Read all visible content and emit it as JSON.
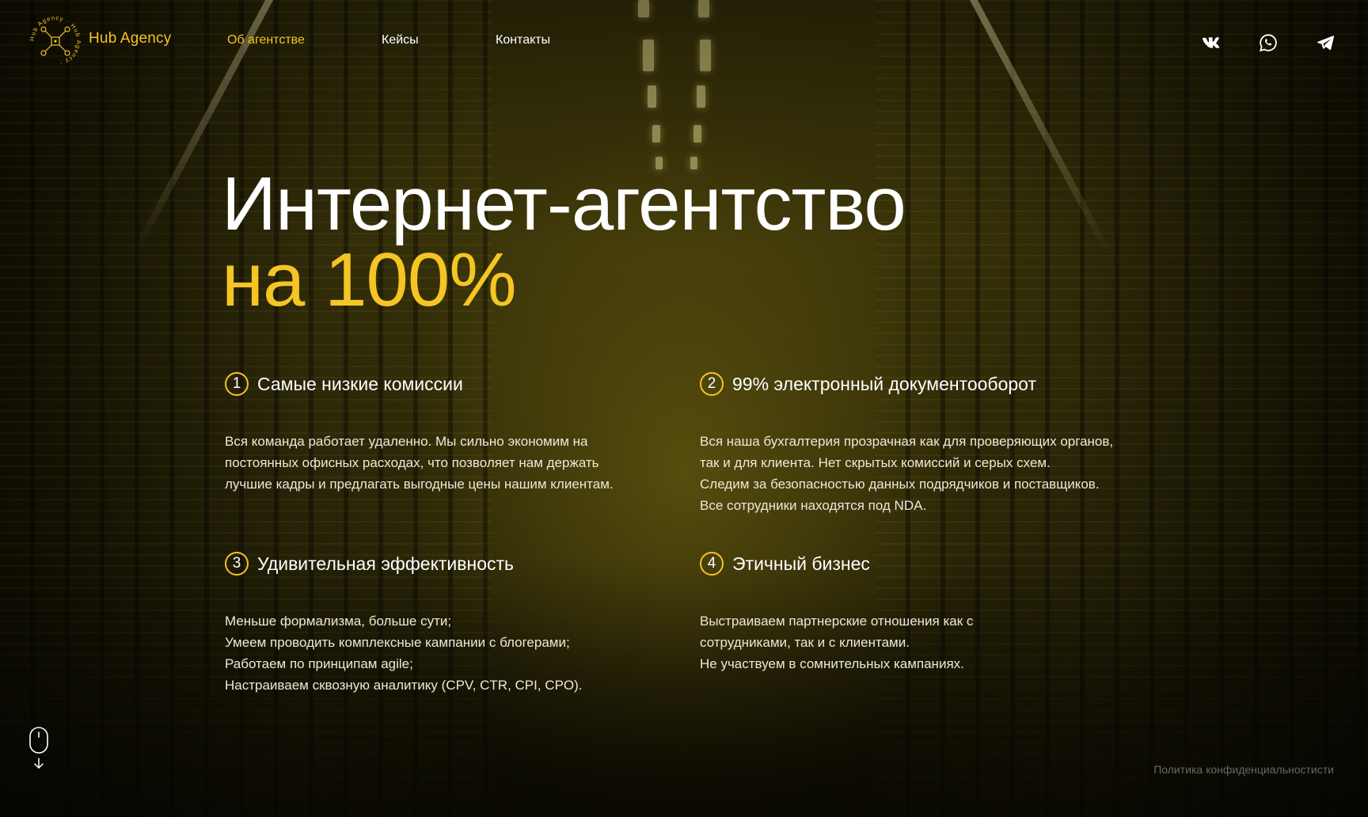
{
  "brand": {
    "name": "Hub Agency",
    "ring_text": "Hub Agency · Hub Agency ·"
  },
  "nav": {
    "items": [
      {
        "label": "Об агентстве",
        "active": true
      },
      {
        "label": "Кейсы",
        "active": false
      },
      {
        "label": "Контакты",
        "active": false
      }
    ]
  },
  "socials": {
    "vk_glyph": "vk"
  },
  "hero": {
    "line1": "Интернет-агентство",
    "line2": "на 100%"
  },
  "features": [
    {
      "number": "1",
      "title": "Самые низкие комиссии",
      "lines": [
        "Вся команда работает удаленно. Мы сильно экономим на",
        "постоянных офисных расходах, что позволяет нам держать",
        "лучшие кадры и предлагать выгодные цены нашим клиентам."
      ]
    },
    {
      "number": "2",
      "title": "99% электронный документооборот",
      "lines": [
        "Вся наша бухгалтерия прозрачная как для проверяющих органов,",
        "так и для клиента. Нет скрытых комиссий и серых схем.",
        "Следим за безопасностью данных подрядчиков и поставщиков.",
        "Все сотрудники находятся под NDA."
      ]
    },
    {
      "number": "3",
      "title": "Удивительная эффективность",
      "lines": [
        "Меньше формализма, больше сути;",
        "Умеем проводить комплексные кампании с блогерами;",
        "Работаем по принципам agile;",
        "Настраиваем сквозную аналитику (CPV, CTR, CPI, CPO)."
      ]
    },
    {
      "number": "4",
      "title": "Этичный бизнес",
      "lines": [
        "Выстраиваем партнерские отношения как с",
        "сотрудниками, так и с клиентами.",
        "Не участвуем в сомнительных кампаниях."
      ]
    }
  ],
  "footer": {
    "privacy": "Политика конфиденциальностисти"
  },
  "colors": {
    "accent": "#f5c524",
    "text": "#ffffff",
    "muted": "#ece8d8"
  }
}
